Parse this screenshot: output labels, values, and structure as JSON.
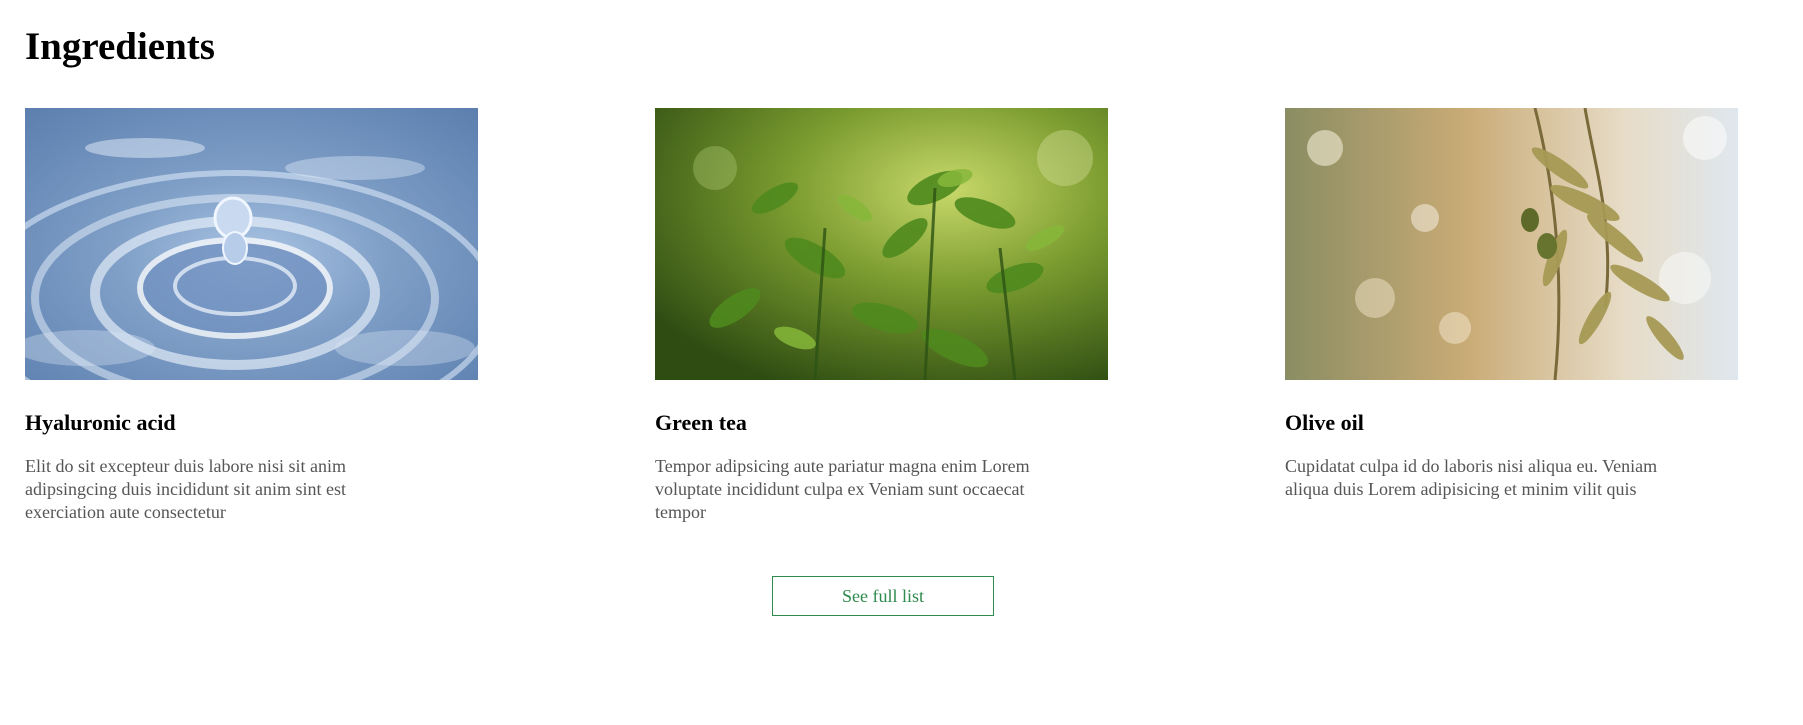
{
  "section": {
    "title": "Ingredients"
  },
  "ingredients": [
    {
      "name": "Hyaluronic acid",
      "description": "Elit do sit excepteur duis labore nisi sit anim adipsingcing duis incididunt sit anim sint est exerciation aute consectetur",
      "image": "water-droplet-photo"
    },
    {
      "name": "Green tea",
      "description": "Tempor adipsicing aute pariatur magna enim Lorem voluptate incididunt culpa ex Veniam sunt occaecat tempor",
      "image": "green-tea-leaves-photo"
    },
    {
      "name": "Olive oil",
      "description": "Cupidatat culpa id do laboris nisi aliqua eu. Veniam aliqua duis Lorem adipisicing et minim vilit quis",
      "image": "olive-branch-photo"
    }
  ],
  "cta": {
    "label": "See full list",
    "color": "#2e8a4d"
  }
}
